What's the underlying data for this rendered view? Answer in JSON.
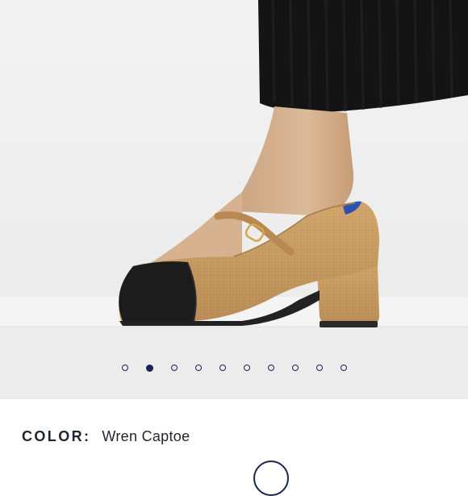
{
  "gallery": {
    "image_alt": "Mary Jane block-heel shoe in Wren Captoe",
    "slide_count": 10,
    "active_index": 1
  },
  "product": {
    "color_label": "COLOR:",
    "color_value": "Wren Captoe"
  },
  "colors": {
    "background": "#f1f1f1",
    "dot": "#1b2450",
    "text": "#1f2530",
    "shoe_knit": "#c49a62",
    "cap_toe": "#1c1c1c",
    "lining_accent": "#2f4fb8"
  }
}
